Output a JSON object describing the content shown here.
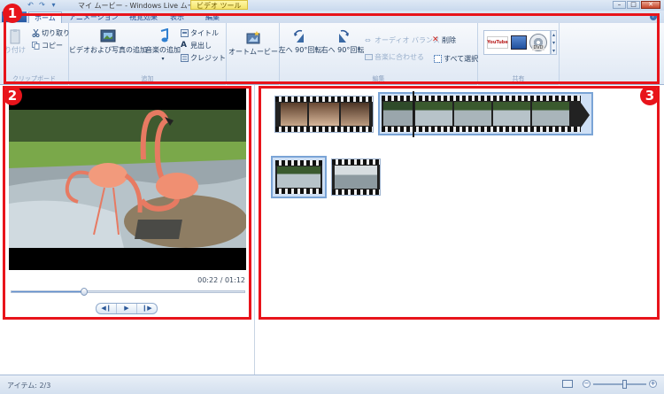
{
  "window": {
    "title": "マイ ムービー - Windows Live ムービー ...",
    "context_tab": "ビデオ ツール"
  },
  "tabs": [
    {
      "label": "ホーム",
      "active": true
    },
    {
      "label": "アニメーション"
    },
    {
      "label": "視覚効果"
    },
    {
      "label": "表示"
    },
    {
      "label": "編集"
    }
  ],
  "ribbon": {
    "clipboard": {
      "label": "クリップボード",
      "paste": "り付け",
      "cut": "切り取り",
      "copy": "コピー"
    },
    "add": {
      "label": "追加",
      "add_video_photo": "ビデオおよび写真の追加",
      "add_music": "音楽の追加",
      "title": "タイトル",
      "caption": "見出し",
      "credits": "クレジット"
    },
    "automovie": {
      "label": "オートムービー"
    },
    "edit": {
      "label": "編集",
      "rotate_left": "左へ 90°回転",
      "rotate_right": "右へ 90°回転",
      "audio_balance": "オーディオ バランス",
      "fit_to_music": "音楽に合わせる",
      "delete": "削除",
      "select_all": "すべて選択"
    },
    "share": {
      "label": "共有",
      "youtube": "YouTube",
      "dvd": "DVD"
    }
  },
  "annotations": {
    "badge1": "1",
    "badge2": "2",
    "badge3": "3"
  },
  "preview": {
    "time": "00:22 / 01:12",
    "progress": 0.31
  },
  "status": {
    "items": "アイテム: 2/3",
    "zoom": 0.6
  },
  "colors": {
    "annotation": "#e8141b",
    "ribbon_text": "#1e395b",
    "accent": "#2b5797"
  }
}
